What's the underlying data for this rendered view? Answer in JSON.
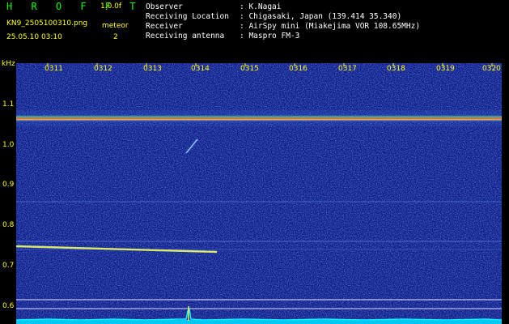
{
  "app": {
    "title": "H R O F F T",
    "version": "1.0.0f"
  },
  "file": {
    "name": "KN9_2505100310.png",
    "timestamp": "25.05.10 03:10"
  },
  "meteor": {
    "label": "meteor",
    "count": "2"
  },
  "info": [
    {
      "label": "Observer",
      "value": ": K.Nagai"
    },
    {
      "label": "Receiving Location",
      "value": ": Chigasaki, Japan (139.414 35.340)"
    },
    {
      "label": "Receiver",
      "value": ": AirSpy mini (Miakejima VOR 108.65MHz)"
    },
    {
      "label": "Receiving antenna",
      "value": ": Maspro FM-3"
    }
  ],
  "y_axis": {
    "unit": "kHz",
    "ticks": [
      "1.1",
      "1.0",
      "0.9",
      "0.8",
      "0.7",
      "0.6"
    ]
  },
  "x_axis": {
    "ticks": [
      "0311",
      "0312",
      "0313",
      "0314",
      "0315",
      "0316",
      "0317",
      "0318",
      "0319",
      "0320"
    ]
  },
  "colors": {
    "background": "#0a1a7a",
    "carrier": "#ff3030",
    "text_yellow": "#ffff00",
    "title_green": "#00ff00"
  }
}
